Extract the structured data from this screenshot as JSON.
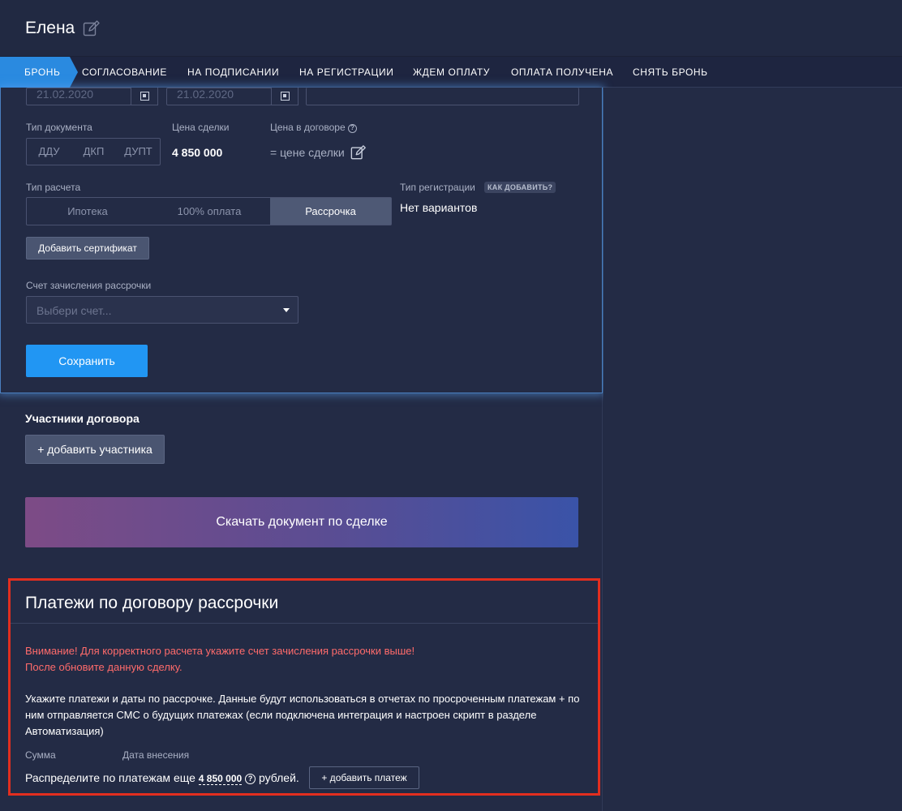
{
  "header": {
    "name": "Елена",
    "edit_icon": "pencil-square-icon"
  },
  "tabs": [
    {
      "label": "БРОНЬ",
      "active": true
    },
    {
      "label": "СОГЛАСОВАНИЕ"
    },
    {
      "label": "НА ПОДПИСАНИИ"
    },
    {
      "label": "НА РЕГИСТРАЦИИ"
    },
    {
      "label": "ЖДЕМ ОПЛАТУ"
    },
    {
      "label": "ОПЛАТА ПОЛУЧЕНА"
    },
    {
      "label": "СНЯТЬ БРОНЬ"
    }
  ],
  "form": {
    "date1": "21.02.2020",
    "date2": "21.02.2020",
    "doc_type_label": "Тип документа",
    "doc_types": [
      "ДДУ",
      "ДКП",
      "ДУПТ"
    ],
    "deal_price_label": "Цена сделки",
    "deal_price": "4 850 000",
    "contract_price_label": "Цена в договоре",
    "contract_price_value": "= цене сделки",
    "payment_type_label": "Тип расчета",
    "payment_types": [
      "Ипотека",
      "100% оплата",
      "Рассрочка"
    ],
    "payment_type_active": "Рассрочка",
    "reg_type_label": "Тип регистрации",
    "reg_type_badge": "КАК ДОБАВИТЬ?",
    "reg_type_value": "Нет вариантов",
    "add_certificate": "Добавить сертификат",
    "account_label": "Счет зачисления рассрочки",
    "account_placeholder": "Выбери счет...",
    "save": "Сохранить"
  },
  "participants": {
    "title": "Участники договора",
    "add_button": "+ добавить участника"
  },
  "download_button": "Скачать документ по сделке",
  "payments": {
    "title": "Платежи по договору рассрочки",
    "warning_line1": "Внимание! Для корректного расчета укажите счет зачисления рассрочки выше!",
    "warning_line2": "После обновите данную сделку.",
    "description": "Укажите платежи и даты по рассрочке. Данные будут использоваться в отчетах по просроченным платежам + по ним отправляется СМС о будущих платежах (если подключена интеграция и настроен скрипт в разделе Автоматизация)",
    "col_sum": "Сумма",
    "col_date": "Дата внесения",
    "distribute_prefix": "Распределите по платежам еще",
    "distribute_amount": "4 850 000",
    "distribute_suffix": "рублей.",
    "add_payment": "+ добавить платеж"
  },
  "colors": {
    "background": "#232b45",
    "accent": "#2196f3",
    "warning": "#ff6b6b",
    "highlight_border": "#e22e1f"
  }
}
